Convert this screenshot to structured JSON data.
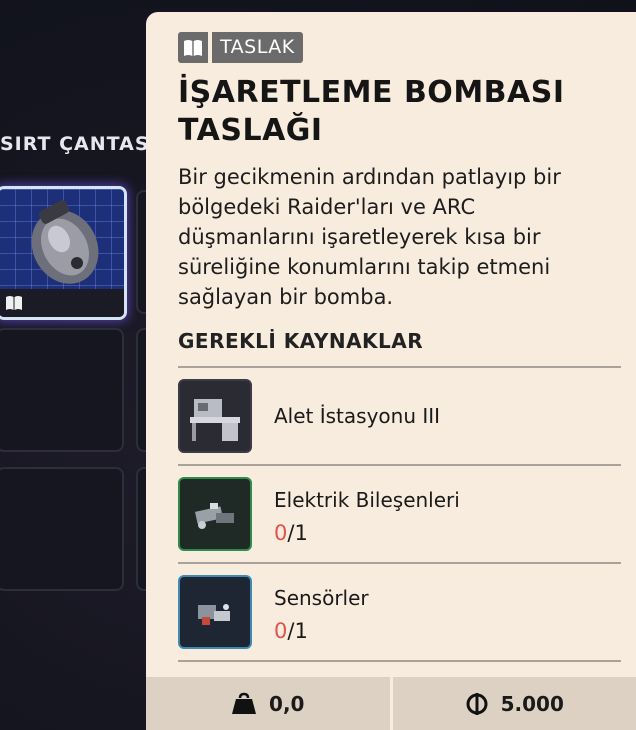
{
  "backpack": {
    "label": "SIRT ÇANTASI"
  },
  "detail": {
    "tag": "TASLAK",
    "title": "İŞARETLEME BOMBASI TASLAĞI",
    "description": "Bir gecikmenin ardından patlayıp bir bölgedeki Raider'ları ve ARC düşmanlarını işaretleyerek kısa bir süreliğine konumlarını takip etmeni sağlayan bir bomba.",
    "required_header": "GEREKLİ KAYNAKLAR",
    "requirements": [
      {
        "name": "Alet İstasyonu III",
        "icon": "workbench-icon"
      },
      {
        "name": "Elektrik Bileşenleri",
        "have": "0",
        "need": "/1",
        "icon": "electrical-components-icon"
      },
      {
        "name": "Sensörler",
        "have": "0",
        "need": "/1",
        "icon": "sensors-icon"
      }
    ],
    "footer": {
      "weight": "0,0",
      "price": "5.000"
    }
  },
  "colors": {
    "panel_bg": "#f8ecdf",
    "tag_bg": "#6b6b6b",
    "missing_qty": "#e0524b",
    "footer_bg": "#ddd1c4"
  }
}
